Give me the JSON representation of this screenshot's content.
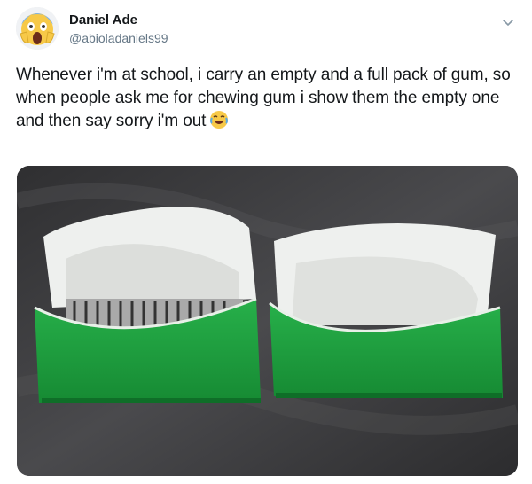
{
  "author": {
    "display_name": "Daniel Ade",
    "handle": "@abioladaniels99",
    "avatar_icon": "screaming-face-emoji"
  },
  "tweet": {
    "text": "Whenever i'm at school, i carry an empty and a full pack of gum, so when people ask me for chewing gum i show them the empty one and then say sorry i'm out",
    "emoji": "face-with-tears-of-joy"
  },
  "menu": {
    "icon": "chevron-down-icon"
  },
  "media": {
    "description_icon": "photo",
    "pack_colors": {
      "green": "#1d9a3a",
      "foil": "#ecedea"
    }
  }
}
